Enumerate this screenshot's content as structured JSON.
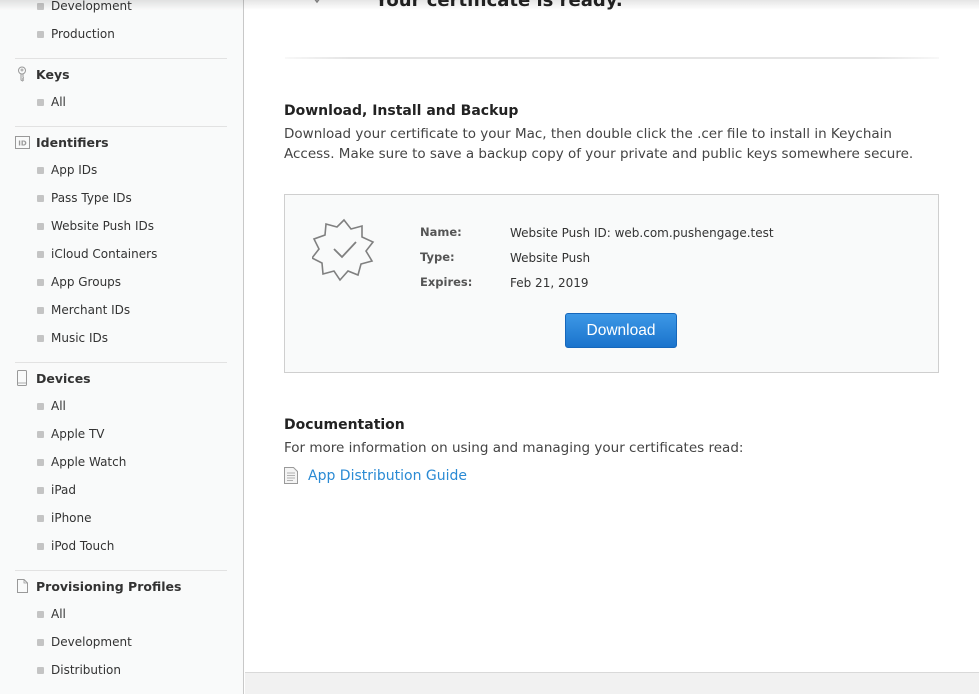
{
  "sidebar": {
    "certificates_partial": {
      "items": [
        "Development",
        "Production"
      ]
    },
    "keys": {
      "title": "Keys",
      "icon": "key-icon",
      "items": [
        "All"
      ]
    },
    "identifiers": {
      "title": "Identifiers",
      "icon": "id-icon",
      "icon_text": "ID",
      "items": [
        "App IDs",
        "Pass Type IDs",
        "Website Push IDs",
        "iCloud Containers",
        "App Groups",
        "Merchant IDs",
        "Music IDs"
      ]
    },
    "devices": {
      "title": "Devices",
      "icon": "device-icon",
      "items": [
        "All",
        "Apple TV",
        "Apple Watch",
        "iPad",
        "iPhone",
        "iPod Touch"
      ]
    },
    "profiles": {
      "title": "Provisioning Profiles",
      "icon": "document-icon",
      "items": [
        "All",
        "Development",
        "Distribution"
      ]
    }
  },
  "main": {
    "title": "Your certificate is ready.",
    "title_icon": "certificate-badge-icon",
    "download_section": {
      "title": "Download, Install and Backup",
      "text": "Download your certificate to your Mac, then double click the .cer file to install in Keychain Access. Make sure to save a backup copy of your private and public keys somewhere secure."
    },
    "certificate": {
      "icon": "certificate-check-icon",
      "fields": [
        {
          "label": "Name:",
          "value": "Website Push ID: web.com.pushengage.test"
        },
        {
          "label": "Type:",
          "value": "Website Push"
        },
        {
          "label": "Expires:",
          "value": "Feb 21, 2019"
        }
      ],
      "download_label": "Download"
    },
    "documentation": {
      "title": "Documentation",
      "text": "For more information on using and managing your certificates read:",
      "link_label": "App Distribution Guide",
      "link_icon": "document-icon"
    }
  },
  "colors": {
    "accent": "#1a73cc",
    "link": "#2a8ad4",
    "sidebar_bg": "#f9fafa"
  }
}
